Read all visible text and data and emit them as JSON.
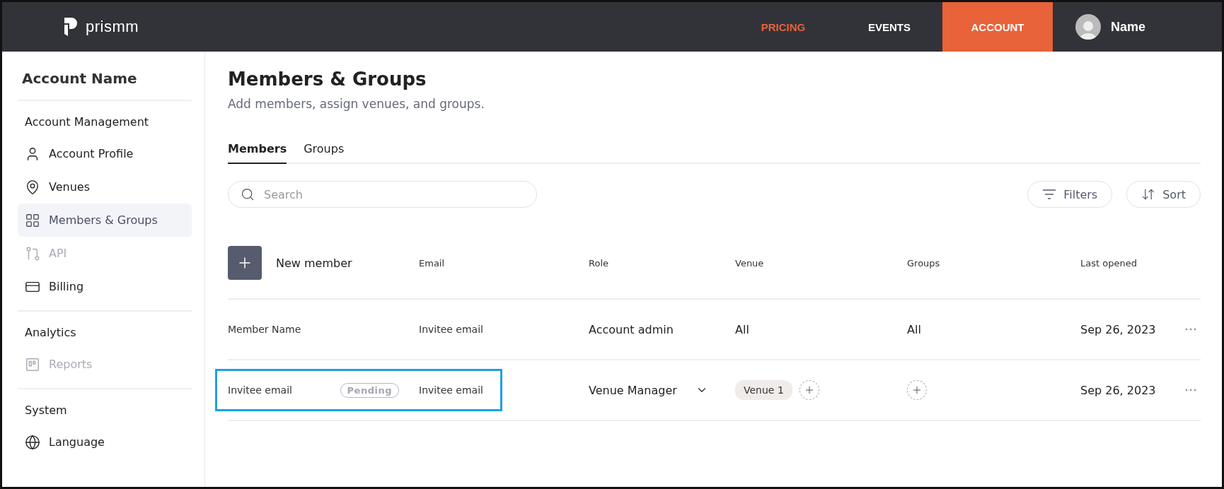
{
  "topbar": {
    "logo": "prismm",
    "nav": [
      {
        "label": "PRICING",
        "accent": true,
        "selected": false
      },
      {
        "label": "EVENTS",
        "accent": false,
        "selected": false
      },
      {
        "label": "ACCOUNT",
        "accent": false,
        "selected": true
      }
    ],
    "user": "Name"
  },
  "sidebar": {
    "title": "Account Name",
    "sections": [
      {
        "heading": "Account Management",
        "items": [
          {
            "label": "Account Profile",
            "selected": false,
            "disabled": false
          },
          {
            "label": "Venues",
            "selected": false,
            "disabled": false
          },
          {
            "label": "Members & Groups",
            "selected": true,
            "disabled": false
          },
          {
            "label": "API",
            "selected": false,
            "disabled": true
          },
          {
            "label": "Billing",
            "selected": false,
            "disabled": false
          }
        ]
      },
      {
        "heading": "Analytics",
        "items": [
          {
            "label": "Reports",
            "selected": false,
            "disabled": true
          }
        ]
      },
      {
        "heading": "System",
        "items": [
          {
            "label": "Language",
            "selected": false,
            "disabled": false
          }
        ]
      }
    ]
  },
  "page": {
    "title": "Members & Groups",
    "subtitle": "Add members, assign venues, and groups."
  },
  "tabs": [
    {
      "label": "Members",
      "selected": true
    },
    {
      "label": "Groups",
      "selected": false
    }
  ],
  "search": {
    "placeholder": "Search"
  },
  "toolbar": [
    "Filters",
    "Sort"
  ],
  "table": {
    "new_member": "New member",
    "columns": [
      "Email",
      "Role",
      "Venue",
      "Groups",
      "Last opened"
    ],
    "rows": [
      {
        "name": "Member Name",
        "badge": null,
        "email": "Invitee email",
        "role": "Account admin",
        "role_dropdown": false,
        "venue": {
          "kind": "text",
          "text": "All"
        },
        "groups": {
          "kind": "text",
          "text": "All"
        },
        "last_opened": "Sep 26, 2023",
        "highlighted": false
      },
      {
        "name": "Invitee email",
        "badge": "Pending",
        "email": "Invitee email",
        "role": "Venue Manager",
        "role_dropdown": true,
        "venue": {
          "kind": "chips",
          "chips": [
            "Venue 1"
          ]
        },
        "groups": {
          "kind": "add"
        },
        "last_opened": "Sep 26, 2023",
        "highlighted": true
      }
    ]
  }
}
